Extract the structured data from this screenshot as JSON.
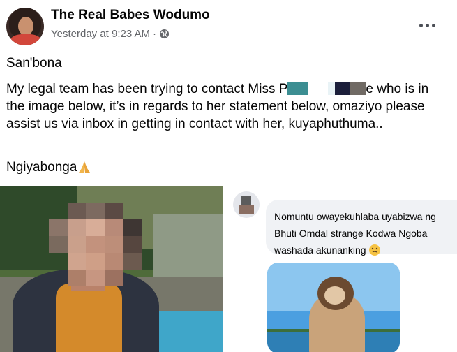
{
  "post": {
    "author": "The Real Babes Wodumo",
    "timestamp": "Yesterday at 9:23 AM",
    "separator": "·",
    "privacy_icon": "globe-icon",
    "more_icon": "more-options-icon",
    "greeting": "San'bona",
    "body_part1": "My legal team has been trying to contact Miss P",
    "body_part2": "e who is in the image below, it’s in regards to her statement below, omaziyo please assist us via inbox in getting in contact with her, kuyaphuthuma..",
    "thanks": "Ngiyabonga",
    "thanks_emoji": "folded-hands-icon"
  },
  "screenshot_comment": {
    "line1": "Nomuntu owayekuhlaba uyabizwa ng",
    "line2": "Bhuti Omdal strange Kodwa Ngoba",
    "line3": "washada akunanking",
    "emoji": "thinking-face-icon"
  },
  "colors": {
    "secondary_text": "#65676b",
    "bubble_bg": "#f0f2f5",
    "redaction_teal": "#3c8e92",
    "redaction_navy": "#1c1f3b"
  }
}
